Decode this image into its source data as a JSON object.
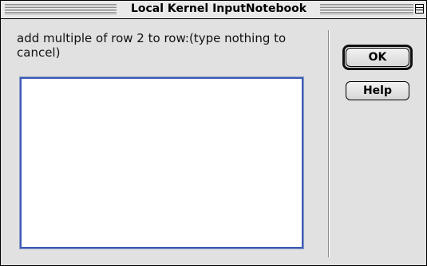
{
  "window": {
    "title": "Local Kernel InputNotebook"
  },
  "dialog": {
    "prompt": "add multiple of row 2 to row:(type nothing to cancel)",
    "input_value": "",
    "ok_label": "OK",
    "help_label": "Help"
  },
  "colors": {
    "window_bg": "#e1e1e1",
    "input_border": "#3b5bb5",
    "input_bg": "#ffffff"
  },
  "icons": {
    "collapse": "collapse-box-icon"
  }
}
